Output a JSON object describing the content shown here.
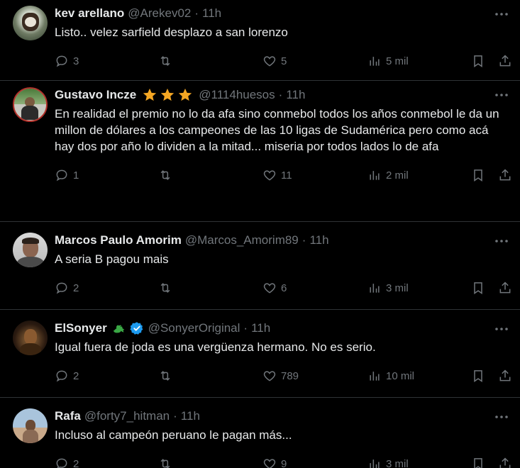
{
  "tweets": [
    {
      "name": "kev arellano",
      "handle": "@Arekev02",
      "time": "11h",
      "text": "Listo.. velez sarfield desplazo a san lorenzo",
      "replies": "3",
      "likes": "5",
      "views": "5 mil"
    },
    {
      "name": "Gustavo Incze",
      "handle": "@1114huesos",
      "time": "11h",
      "text": "En realidad el premio no lo da afa sino conmebol todos los años conmebol le da un millon de dólares a los campeones de las 10 ligas de Sudamérica pero como acá hay dos por año lo dividen a la mitad... miseria por todos lados lo de afa",
      "replies": "1",
      "likes": "11",
      "views": "2 mil"
    },
    {
      "name": "Marcos Paulo Amorim",
      "handle": "@Marcos_Amorim89",
      "time": "11h",
      "text": "A seria B pagou mais",
      "replies": "2",
      "likes": "6",
      "views": "3 mil"
    },
    {
      "name": "ElSonyer",
      "handle": "@SonyerOriginal",
      "time": "11h",
      "text": "Igual fuera de joda es una vergüenza hermano. No es serio.",
      "replies": "2",
      "likes": "789",
      "views": "10 mil"
    },
    {
      "name": "Rafa",
      "handle": "@forty7_hitman",
      "time": "11h",
      "text": "Incluso al campeón peruano le pagan más...",
      "replies": "2",
      "likes": "9",
      "views": "3 mil"
    }
  ],
  "separator": "·",
  "colors": {
    "background": "#000000",
    "text": "#e7e9ea",
    "muted": "#71767b",
    "border": "#2f3336",
    "star": "#f4a623",
    "verified": "#1d9bf0"
  },
  "icons": [
    "reply-icon",
    "retweet-icon",
    "like-icon",
    "views-icon",
    "bookmark-icon",
    "share-icon",
    "more-icon",
    "star-icon",
    "verified-icon",
    "dragon-icon"
  ]
}
